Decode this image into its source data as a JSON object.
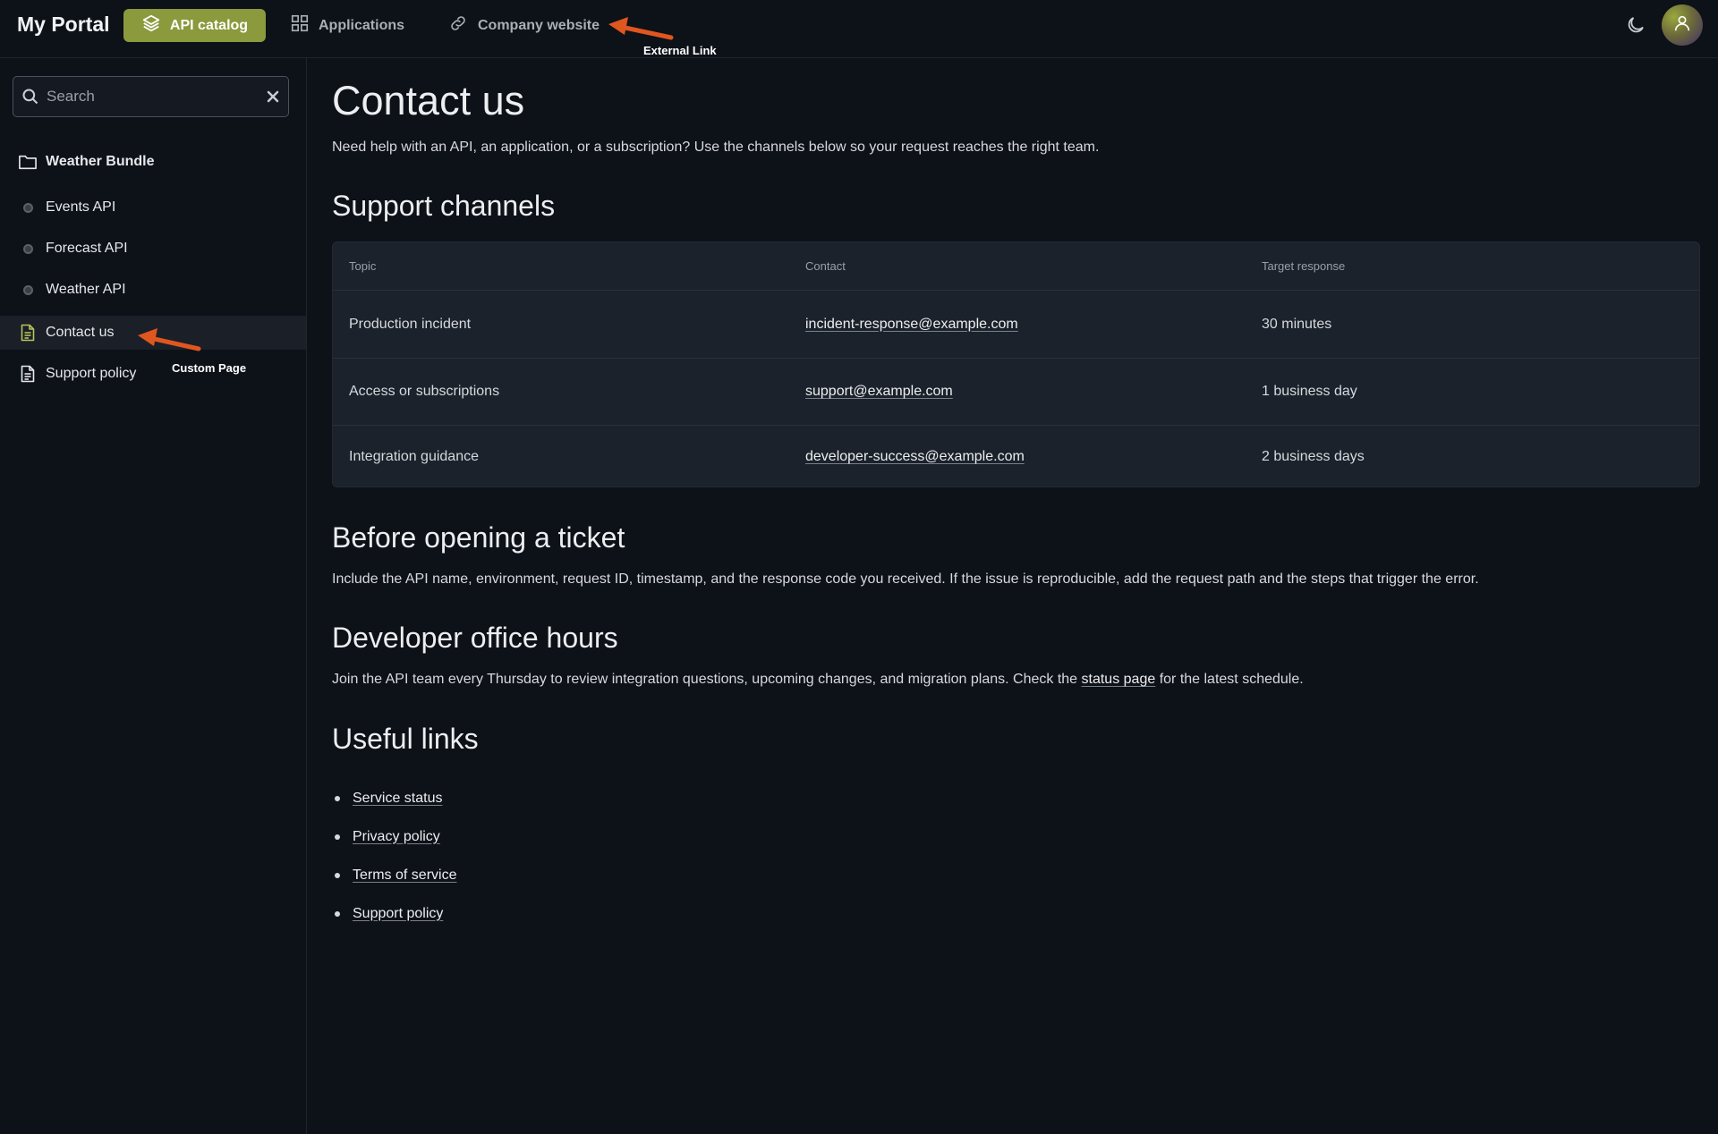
{
  "header": {
    "brand": "My Portal",
    "nav": [
      {
        "label": "API catalog",
        "icon": "layers-icon",
        "active": true
      },
      {
        "label": "Applications",
        "icon": "grid-icon"
      },
      {
        "label": "Company website",
        "icon": "link-icon"
      }
    ],
    "theme_icon": "moon-icon",
    "avatar_icon": "user-icon"
  },
  "annotations": {
    "external_link": "External Link",
    "custom_page": "Custom Page"
  },
  "sidebar": {
    "search_placeholder": "Search",
    "items": [
      {
        "label": "Weather Bundle",
        "icon": "folder-icon"
      },
      {
        "label": "Events API",
        "icon": "dot-icon"
      },
      {
        "label": "Forecast API",
        "icon": "dot-icon"
      },
      {
        "label": "Weather API",
        "icon": "dot-icon"
      },
      {
        "label": "Contact us",
        "icon": "document-icon",
        "active": true
      },
      {
        "label": "Support policy",
        "icon": "document-icon"
      }
    ]
  },
  "main": {
    "title": "Contact us",
    "intro": "Need help with an API, an application, or a subscription? Use the channels below so your request reaches the right team.",
    "support": {
      "heading": "Support channels",
      "columns": [
        "Topic",
        "Contact",
        "Target response"
      ],
      "rows": [
        [
          "Production incident",
          "incident-response@example.com",
          "30 minutes"
        ],
        [
          "Access or subscriptions",
          "support@example.com",
          "1 business day"
        ],
        [
          "Integration guidance",
          "developer-success@example.com",
          "2 business days"
        ]
      ]
    },
    "ticket": {
      "heading": "Before opening a ticket",
      "text": "Include the API name, environment, request ID, timestamp, and the response code you received. If the issue is reproducible, add the request path and the steps that trigger the error."
    },
    "office": {
      "heading": "Developer office hours",
      "text_before": "Join the API team every Thursday to review integration questions, upcoming changes, and migration plans. Check the ",
      "link": "status page",
      "text_after": " for the latest schedule."
    },
    "useful": {
      "heading": "Useful links",
      "links": [
        "Service status",
        "Privacy policy",
        "Terms of service",
        "Support policy"
      ]
    }
  },
  "colors": {
    "background": "#0d1118",
    "accent": "#8a9a3c",
    "annotation_arrow": "#e0561f"
  }
}
